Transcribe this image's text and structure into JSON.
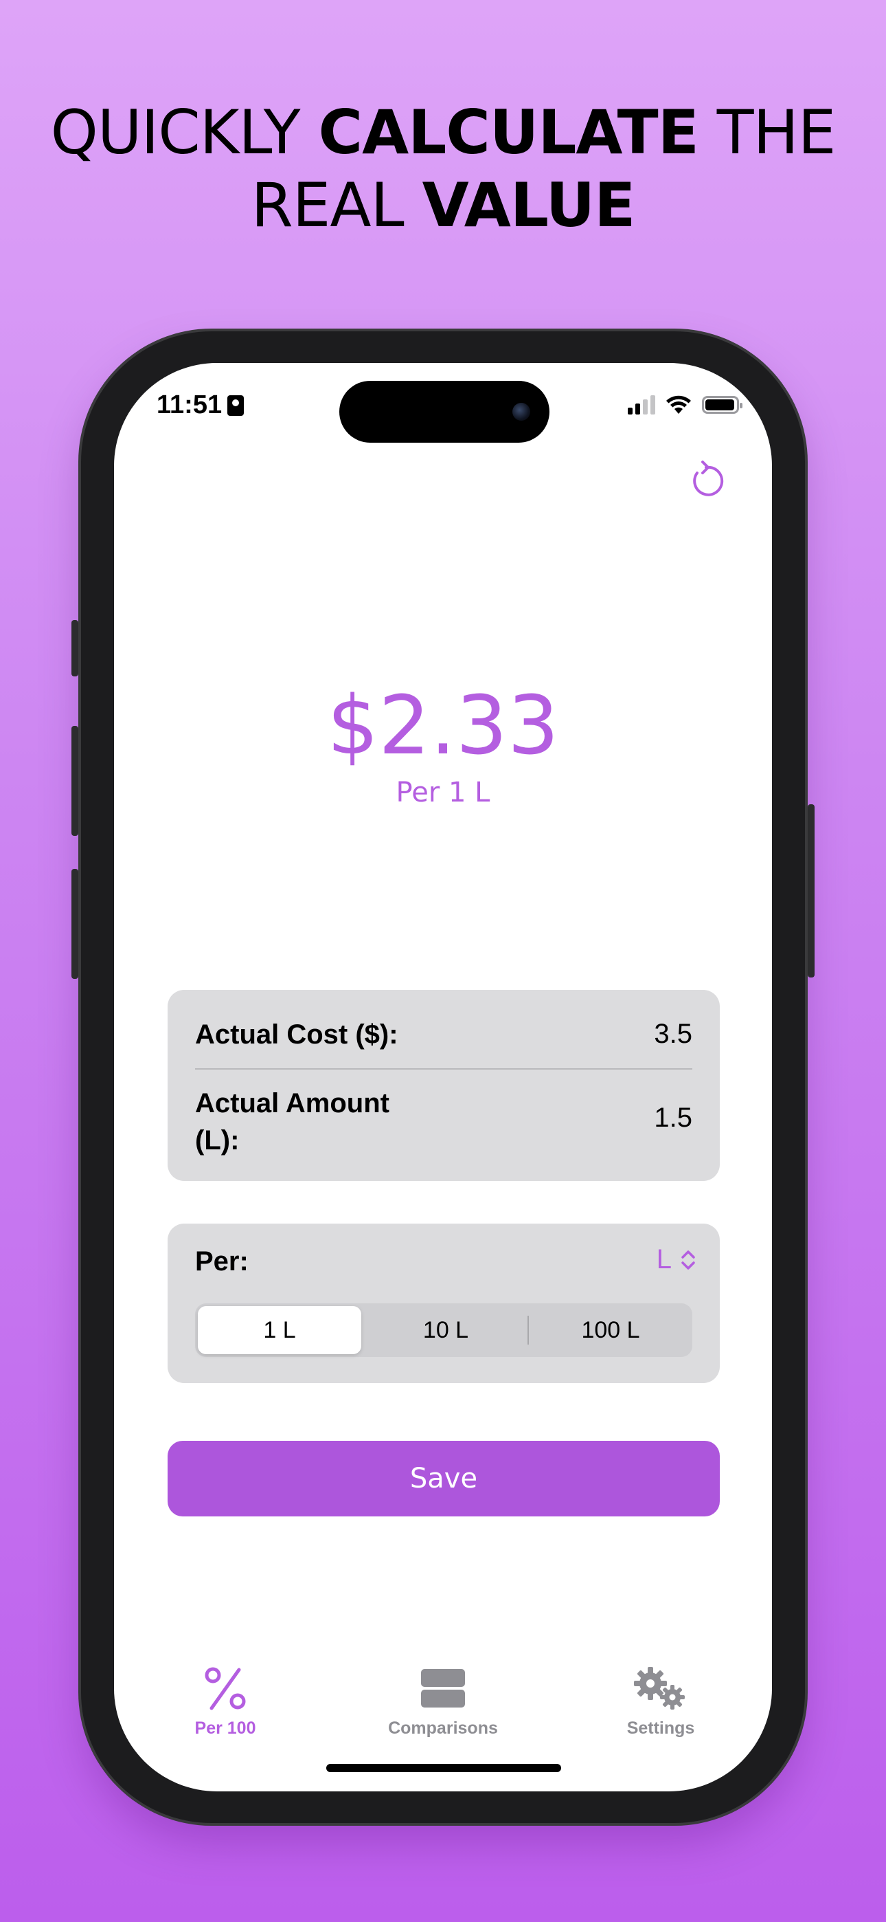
{
  "headline": {
    "line1_light": "QUICKLY ",
    "line1_bold": "CALCULATE",
    "line1_light2": " THE",
    "line2_light": "REAL ",
    "line2_bold": "VALUE"
  },
  "status_bar": {
    "time": "11:51"
  },
  "result": {
    "price": "$2.33",
    "per_label": "Per 1 L"
  },
  "inputs": {
    "cost_label": "Actual Cost ($):",
    "cost_value": "3.5",
    "amount_label_line1": "Actual Amount",
    "amount_label_line2": "(L):",
    "amount_value": "1.5"
  },
  "per_section": {
    "label": "Per:",
    "unit": "L",
    "options": [
      "1 L",
      "10 L",
      "100 L"
    ],
    "selected": "1 L"
  },
  "save_label": "Save",
  "tabs": [
    {
      "label": "Per 100",
      "icon": "percent-icon",
      "active": true
    },
    {
      "label": "Comparisons",
      "icon": "stack-icon",
      "active": false
    },
    {
      "label": "Settings",
      "icon": "gears-icon",
      "active": false
    }
  ],
  "colors": {
    "accent": "#b45ee0",
    "button": "#ad56dc",
    "background_top": "#dea4f8",
    "background_bottom": "#bc5eec"
  }
}
